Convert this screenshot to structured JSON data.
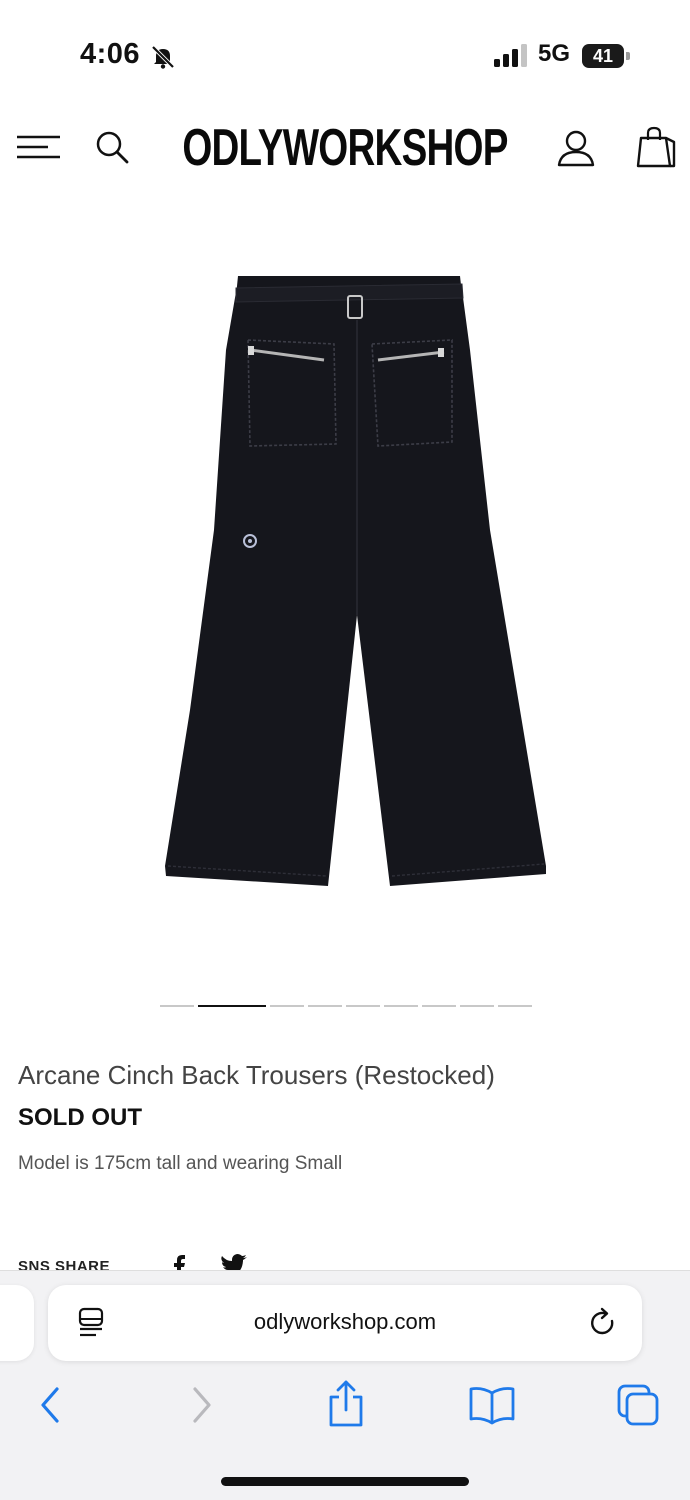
{
  "status_bar": {
    "time": "4:06",
    "network": "5G",
    "battery": "41",
    "icons": [
      "bell-slash-icon",
      "signal-icon",
      "battery-icon"
    ]
  },
  "header": {
    "logo": "ODLYWORKSHOP",
    "icons": [
      "menu-icon",
      "search-icon",
      "account-icon",
      "shopping-bag-icon"
    ]
  },
  "product": {
    "title": "Arcane Cinch Back Trousers (Restocked)",
    "status": "SOLD OUT",
    "note": "Model is 175cm tall and wearing Small",
    "image_count": 9,
    "active_image": 2
  },
  "share": {
    "label": "SNS SHARE",
    "icons": [
      "facebook-icon",
      "twitter-icon"
    ]
  },
  "browser": {
    "url": "odlyworkshop.com",
    "icons": [
      "reader-icon",
      "reload-icon",
      "back-icon",
      "forward-icon",
      "share-icon",
      "bookmarks-icon",
      "tabs-icon"
    ]
  },
  "colors": {
    "accent": "#1f7aea",
    "disabled": "#b9b9bd",
    "garment": "#15161c"
  }
}
